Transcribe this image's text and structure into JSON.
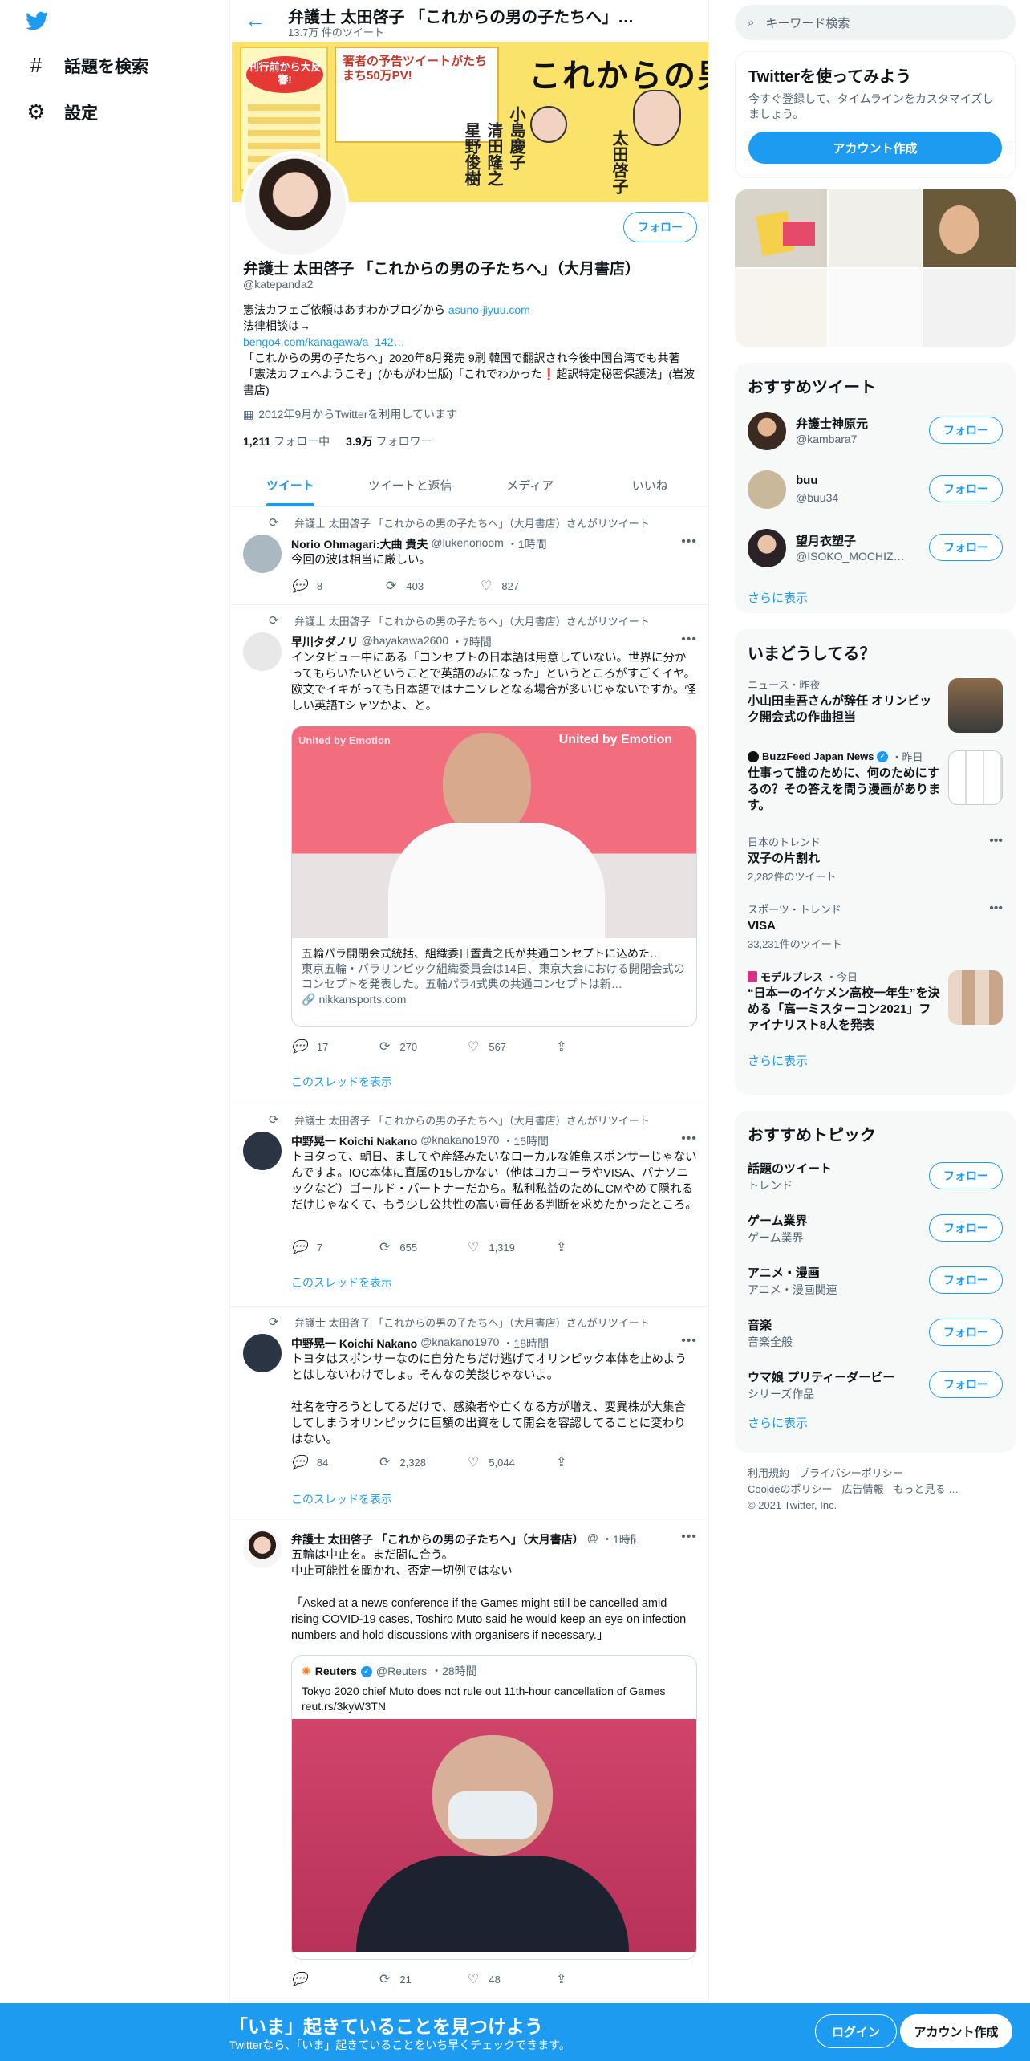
{
  "nav": {
    "explore": "話題を検索",
    "settings": "設定"
  },
  "header": {
    "name": "弁護士 太田啓子 「これからの男の子たちへ」…",
    "tweet_count": "13.7万 件のツイート"
  },
  "banner": {
    "poster_badge": "刊行前から大反響!",
    "headline": "著者の予告ツイートがたちまち50万PV!",
    "book_title": "これからの男の子たちへ",
    "guests": [
      "小島慶子",
      "清田隆之",
      "星野俊樹"
    ],
    "author": "太田啓子"
  },
  "profile": {
    "follow_label": "フォロー",
    "name": "弁護士 太田啓子 「これからの男の子たちへ」（大月書店）",
    "handle": "@katepanda2",
    "bio_line1": "憲法カフェご依頼はあすわかブログから",
    "bio_link1": "asuno-jiyuu.com",
    "bio_line2": "法律相談は→",
    "bio_link2": "bengo4.com/kanagawa/a_142…",
    "bio_line3": "「これからの男の子たちへ」2020年8月発売 9刷 韓国で翻訳され今後中国台湾でも共著「憲法カフェへようこそ」(かもがわ出版)「これでわかった❗超訳特定秘密保護法」(岩波書店)",
    "joined": "2012年9月からTwitterを利用しています",
    "following_count": "1,211",
    "following_label": "フォロー中",
    "followers_count": "3.9万",
    "followers_label": "フォロワー"
  },
  "tabs": [
    "ツイート",
    "ツイートと返信",
    "メディア",
    "いいね"
  ],
  "retweet_label": "弁護士 太田啓子 「これからの男の子たちへ」（大月書店）さんがリツイート",
  "show_thread": "このスレッドを表示",
  "tweets": [
    {
      "name": "Norio Ohmagari:大曲 貴夫",
      "handle": "@lukenorioom",
      "time": "・1時間",
      "text": "今回の波は相当に厳しい。",
      "replies": "8",
      "retweets": "403",
      "likes": "827"
    },
    {
      "name": "早川タダノリ",
      "handle": "@hayakawa2600",
      "time": "・7時間",
      "text": "インタビュー中にある「コンセプトの日本語は用意していない。世界に分かってもらいたいということで英語のみになった」というところがすごくイヤ。欧文でイキがっても日本語ではナニソレとなる場合が多いじゃないですか。怪しい英語Tシャツかよ、と。",
      "card_title": "五輪パラ開閉会式統括、組織委日置貴之氏が共通コンセプトに込めた…",
      "card_desc": "東京五輪・パラリンピック組織委員会は14日、東京大会における開閉会式のコンセプトを発表した。五輪パラ4式典の共通コンセプトは新…",
      "card_domain": "nikkansports.com",
      "image_text1": "United by Emotion",
      "image_text2": "United by Emotion",
      "replies": "17",
      "retweets": "270",
      "likes": "567"
    },
    {
      "name": "中野晃一 Koichi Nakano",
      "handle": "@knakano1970",
      "time": "・15時間",
      "text": "トヨタって、朝日、ましてや産経みたいなローカルな雑魚スポンサーじゃないんですよ。IOC本体に直属の15しかない（他はコカコーラやVISA、パナソニックなど）ゴールド・パートナーだから。私利私益のためにCMやめて隠れるだけじゃなくて、もう少し公共性の高い責任ある判断を求めたかったところ。",
      "replies": "7",
      "retweets": "655",
      "likes": "1,319"
    },
    {
      "name": "中野晃一 Koichi Nakano",
      "handle": "@knakano1970",
      "time": "・18時間",
      "text1": "トヨタはスポンサーなのに自分たちだけ逃げてオリンピック本体を止めようとはしないわけでしょ。そんなの美談じゃないよ。",
      "text2": "社名を守ろうとしてるだけで、感染者や亡くなる方が増え、変異株が大集合してしまうオリンピックに巨額の出資をして開会を容認してることに変わりはない。",
      "replies": "84",
      "retweets": "2,328",
      "likes": "5,044"
    },
    {
      "name": "弁護士 太田啓子 「これからの男の子たちへ」（大月書店）",
      "handle": "@",
      "time": "・1時間",
      "text1": "五輪は中止を。まだ間に合う。",
      "text2": "中止可能性を聞かれ、否定一切例ではない",
      "text3": "「Asked at a news conference if the Games might still be cancelled amid rising COVID-19 cases, Toshiro Muto said he would keep an eye on infection numbers and hold discussions with organisers if necessary.」",
      "quote_name": "Reuters",
      "quote_handle": "@Reuters",
      "quote_time": "・28時間",
      "quote_text": "Tokyo 2020 chief Muto does not rule out 11th-hour cancellation of Games reut.rs/3kyW3TN",
      "replies": "",
      "retweets": "21",
      "likes": "48"
    }
  ],
  "right": {
    "search_placeholder": "キーワード検索",
    "signup_title": "Twitterを使ってみよう",
    "signup_sub": "今すぐ登録して、タイムラインをカスタマイズしましょう。",
    "signup_button": "アカウント作成",
    "who_title": "おすすめツイート",
    "who": [
      {
        "name": "弁護士神原元",
        "handle": "@kambara7"
      },
      {
        "name": "buu",
        "handle": "@buu34"
      },
      {
        "name": "望月衣塑子",
        "handle": "@ISOKO_MOCHIZUKI"
      }
    ],
    "follow_label": "フォロー",
    "show_more": "さらに表示",
    "trends_title": "いまどうしてる？",
    "trends": [
      {
        "meta": "ニュース・昨夜",
        "title": "小山田圭吾さんが辞任 オリンピック開会式の作曲担当"
      },
      {
        "meta": "BuzzFeed Japan News",
        "meta_time": "・昨日",
        "title": "仕事って誰のために、何のためにするの？その答えを問う漫画があります。"
      },
      {
        "meta": "日本のトレンド",
        "title": "双子の片割れ",
        "count": "2,282件のツイート"
      },
      {
        "meta": "スポーツ・トレンド",
        "title": "VISA",
        "count": "33,231件のツイート"
      },
      {
        "meta": "モデルプレス",
        "meta_time": "・今日",
        "title": "“日本一のイケメン高校一年生”を決める「高一ミスターコン2021」ファイナリスト8人を発表"
      }
    ],
    "topics_title": "おすすめトピック",
    "topics": [
      {
        "name": "話題のツイート",
        "cat": "トレンド"
      },
      {
        "name": "ゲーム業界",
        "cat": "ゲーム業界"
      },
      {
        "name": "アニメ・漫画",
        "cat": "アニメ・漫画関連"
      },
      {
        "name": "音楽",
        "cat": "音楽全般"
      },
      {
        "name": "ウマ娘 プリティーダービー",
        "cat": "シリーズ作品"
      }
    ],
    "footer": [
      "利用規約",
      "プライバシーポリシー",
      "Cookieのポリシー",
      "広告情報",
      "もっと見る …",
      "© 2021 Twitter, Inc."
    ]
  },
  "bottom": {
    "title": "「いま」起きていることを見つけよう",
    "sub": "Twitterなら、「いま」起きていることをいち早くチェックできます。",
    "login": "ログイン",
    "signup": "アカウント作成"
  },
  "colors": {
    "accent": "#1d9bf0",
    "text": "#0f1419",
    "muted": "#536471"
  }
}
